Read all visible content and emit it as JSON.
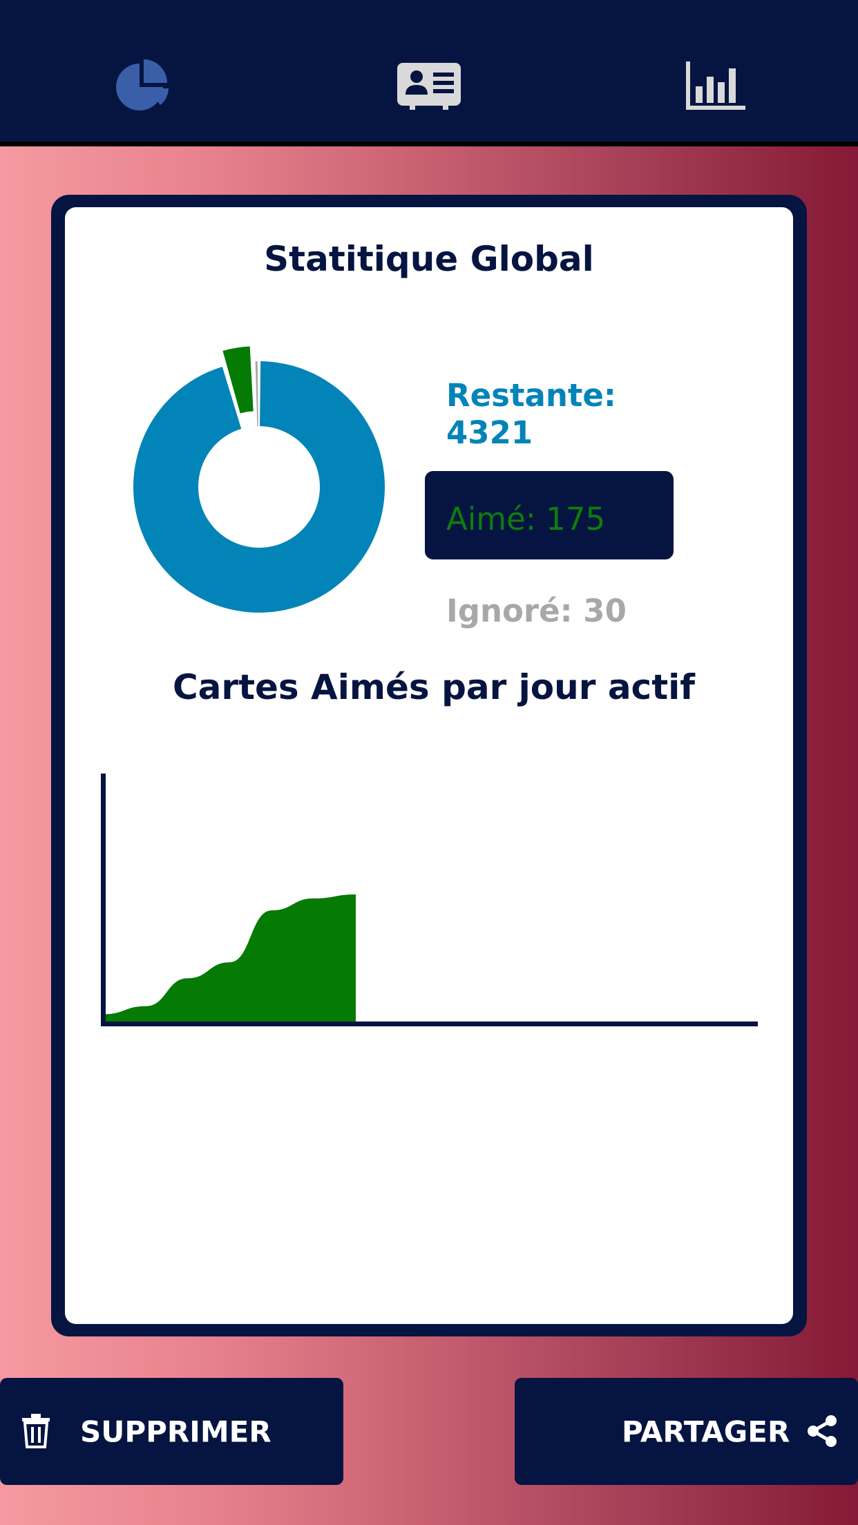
{
  "nav": {
    "tabs": [
      {
        "icon": "pie-chart-icon",
        "color": "#3a5fa8"
      },
      {
        "icon": "id-card-icon",
        "color": "#d9d9d9"
      },
      {
        "icon": "bar-chart-icon",
        "color": "#d9d9d9"
      }
    ]
  },
  "stats": {
    "title": "Statitique Global",
    "remaining_label": "Restante:",
    "remaining_value": "4321",
    "liked_label": "Aimé: 175",
    "ignored_label": "Ignoré: 30",
    "colors": {
      "remaining": "#0384b8",
      "liked": "#057a05",
      "ignored": "#a8a8a8",
      "navy": "#061441"
    },
    "chart_data": {
      "type": "pie",
      "categories": [
        "Restante",
        "Aimé",
        "Ignoré"
      ],
      "values": [
        4321,
        175,
        30
      ]
    }
  },
  "daily": {
    "title": "Cartes Aimés par jour actif",
    "chart_data": {
      "type": "area",
      "x": [
        0,
        1,
        2,
        3,
        4,
        5,
        6
      ],
      "values": [
        10,
        20,
        55,
        75,
        140,
        155,
        160
      ]
    }
  },
  "actions": {
    "delete_label": "SUPPRIMER",
    "share_label": "PARTAGER"
  }
}
